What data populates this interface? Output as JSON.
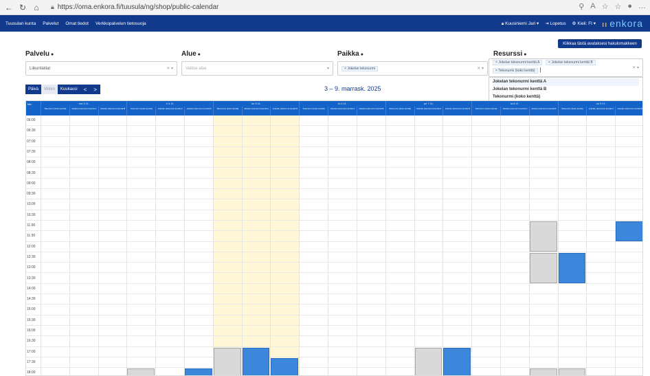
{
  "browser": {
    "url": "https://oma.enkora.fi/tuusula/ng/shop/public-calendar"
  },
  "topnav": {
    "links": [
      "Tuusulan kunta",
      "Palvelut",
      "Omat tiedot",
      "Verkkopalvelun tietosuoja"
    ],
    "user": "Kuusiniemi Jari",
    "logout": "Lopetus",
    "language": "Kieli: FI",
    "brand": "enkora"
  },
  "advanced_search_label": "Klikkaa tästä avataksesi hakulomakkeen",
  "filters": {
    "palvelu": {
      "label": "Palvelu",
      "value": "Liikuntatilat"
    },
    "alue": {
      "label": "Alue",
      "placeholder": "Valitse alue"
    },
    "paikka": {
      "label": "Paikka",
      "tag": "Jokelan tekonurmi"
    },
    "resurssi": {
      "label": "Resurssi",
      "tags": [
        "Jokelan tekonurmi kenttä A",
        "Jokelan tekonurmi kenttä B",
        "Tekonurmi (koko kenttä)"
      ],
      "options": [
        "Jokelan tekonurmi kenttä A",
        "Jokelan tekonurmi kenttä B",
        "Tekonurmi (koko kenttä)"
      ]
    }
  },
  "view": {
    "buttons": [
      "Päivä",
      "Viikko",
      "Kuukausi"
    ],
    "active": "Viikko",
    "prev": "<",
    "next": ">"
  },
  "week_title": "3 – 9. marrask. 2025",
  "calendar": {
    "head_corner": "Ma",
    "days": [
      "ma 3.11.",
      "ti 4.11.",
      "ke 5.11.",
      "to 6.11.",
      "pe 7.11.",
      "la 8.11.",
      "su 9.11."
    ],
    "resource_columns": [
      "Tekonurmi (koko kenttä)",
      "Jokelan tekonurmi kenttä A",
      "Jokelan tekonurmi kenttä B"
    ],
    "times": [
      "06:00",
      "06:30",
      "07:00",
      "07:30",
      "08:00",
      "08:30",
      "09:00",
      "09:30",
      "10:00",
      "10:30",
      "11:00",
      "11:30",
      "12:00",
      "12:30",
      "13:00",
      "13:30",
      "14:00",
      "14:30",
      "15:00",
      "15:30",
      "16:00",
      "16:30",
      "17:00",
      "17:30",
      "18:00"
    ],
    "highlight_day": 2,
    "colors": {
      "header": "#1463c9",
      "booking_blue": "#3c86dc",
      "booking_grey": "#d9d9d9",
      "today": "#fff7d6"
    },
    "events": [
      {
        "day": 5,
        "col": 2,
        "start": "11:00",
        "end": "12:30",
        "kind": "grey"
      },
      {
        "day": 6,
        "col": 2,
        "start": "11:00",
        "end": "12:00",
        "kind": "blue"
      },
      {
        "day": 5,
        "col": 2,
        "start": "12:30",
        "end": "14:00",
        "kind": "grey"
      },
      {
        "day": 6,
        "col": 0,
        "start": "12:30",
        "end": "14:00",
        "kind": "blue"
      },
      {
        "day": 2,
        "col": 0,
        "start": "17:00",
        "end": "18:30",
        "kind": "grey"
      },
      {
        "day": 2,
        "col": 1,
        "start": "17:30",
        "end": "18:30",
        "kind": "grey"
      },
      {
        "day": 2,
        "col": 1,
        "start": "17:00",
        "end": "18:30",
        "kind": "blue"
      },
      {
        "day": 2,
        "col": 2,
        "start": "17:30",
        "end": "18:30",
        "kind": "blue"
      },
      {
        "day": 4,
        "col": 1,
        "start": "17:00",
        "end": "18:30",
        "kind": "grey"
      },
      {
        "day": 4,
        "col": 2,
        "start": "17:00",
        "end": "18:30",
        "kind": "blue"
      },
      {
        "day": 1,
        "col": 0,
        "start": "18:00",
        "end": "18:30",
        "kind": "grey"
      },
      {
        "day": 1,
        "col": 2,
        "start": "18:00",
        "end": "18:30",
        "kind": "blue"
      },
      {
        "day": 5,
        "col": 2,
        "start": "18:00",
        "end": "18:30",
        "kind": "grey"
      },
      {
        "day": 6,
        "col": 0,
        "start": "18:00",
        "end": "18:30",
        "kind": "grey"
      }
    ]
  }
}
